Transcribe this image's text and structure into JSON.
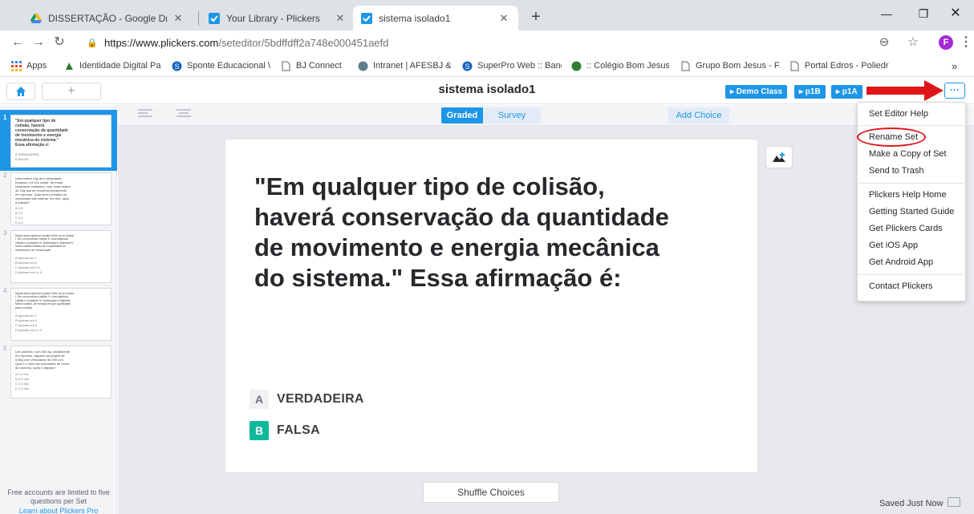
{
  "browser": {
    "tabs": [
      {
        "title": "DISSERTAÇÃO - Google Drive",
        "icon": "google-drive-icon"
      },
      {
        "title": "Your Library - Plickers",
        "icon": "plickers-icon"
      },
      {
        "title": "sistema isolado1",
        "icon": "plickers-icon",
        "active": true
      }
    ],
    "url_host": "https://www.plickers.com",
    "url_path": "/seteditor/5bdffdff2a748e000451aefd",
    "profile_initial": "F",
    "bookmarks": [
      "Apps",
      "Identidade Digital Pa",
      "Sponte Educacional \\",
      "BJ Connect",
      "Intranet | AFESBJ & C",
      "SuperPro Web :: Banc",
      ":: Colégio Bom Jesus",
      "Grupo Bom Jesus - F/",
      "Portal Edros - Poliedr"
    ],
    "bookmarks_overflow": "»"
  },
  "app": {
    "set_title": "sistema isolado1",
    "class_buttons": [
      "▸ Demo Class",
      "▸ p1B",
      "▸ p1A"
    ],
    "more_label": "···"
  },
  "toolbar": {
    "graded_label": "Graded",
    "survey_label": "Survey",
    "add_choice_label": "Add Choice"
  },
  "sidebar": {
    "slides": [
      {
        "number": "1",
        "question": "\"Em qualquer tipo de colisão, haverá conservação da quantidade de movimento e energia mecânica do sistema.\" Essa afirmação é:",
        "choices": [
          "A VERDADEIRA",
          "B FALSA"
        ]
      },
      {
        "number": "2",
        "question": "Uma esfera 10g de e velocidade trocando 4,0 m/s colide, de modo totalmente inelástico, com outra esfera de 10g que se encontra inicialmente em repouso. Qual será o módulo da velocidade das esferas, em m/s, após a colisão?",
        "choices": [
          "A 0,5",
          "B 1,0",
          "C 2,0",
          "D 4,0"
        ]
      },
      {
        "number": "3",
        "question": "Marca antes aparecer podem entre os do estudo. I. Em um processo colisão II. Uma trajetória colisão e constante III. Aceleração e trajetória IV. Numa colisão elástica de e quantidade de movimento e de conservação",
        "choices": [
          "A Apenas em I",
          "B Apenas em II",
          "C Apenas em II e",
          "D Apenas em I e II"
        ]
      },
      {
        "number": "4",
        "question": "Marca antes aparecer podem entre os do estudo. I. Em um processo colisão II. Uma trajetória colisão e constante III. Aceleração e trajetória Marca colisão, de energia em que quantidade para a colisão",
        "choices": [
          "A Apenas em I",
          "B Apenas em II",
          "C Apenas em II",
          "D Apenas em I e II"
        ]
      },
      {
        "number": "5",
        "question": "Um carrinho, com 300 kg, inicialmente em repouso, dispara um projétil de 0,6kg com velocidade de 200 m/s. Qual é o valor da velocidade de recuo do carrinho, após o disparo?",
        "choices": [
          "A 0,1 m/s",
          "B 0,2 m/s",
          "C 0,4 m/s",
          "D 1,0 m/s"
        ]
      }
    ],
    "limit_note": "Free accounts are limited to five questions per Set",
    "pro_link": "Learn about Plickers Pro"
  },
  "editor": {
    "question": "\"Em qualquer tipo de colisão, haverá conservação da quantidade de movimento e energia mecânica do sistema.\" Essa afirmação é:",
    "choices": [
      {
        "letter": "A",
        "text": "VERDADEIRA",
        "correct": false
      },
      {
        "letter": "B",
        "text": "FALSA",
        "correct": true
      }
    ],
    "shuffle_label": "Shuffle Choices",
    "save_status": "Saved Just Now"
  },
  "menu": {
    "items": [
      "Set Editor Help",
      "Rename Set",
      "Make a Copy of Set",
      "Send to Trash",
      "Plickers Help Home",
      "Getting Started Guide",
      "Get Plickers Cards",
      "Get iOS App",
      "Get Android App",
      "Contact Plickers"
    ],
    "highlighted_item": "Rename Set"
  },
  "colors": {
    "accent": "#1e96e8",
    "correct": "#11b89c",
    "annotation": "#e0151a"
  }
}
